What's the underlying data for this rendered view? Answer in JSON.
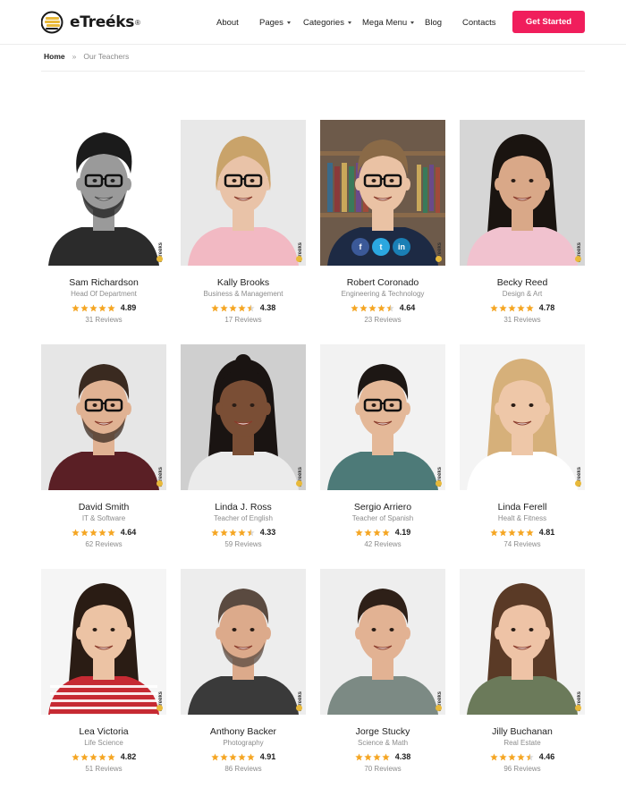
{
  "brand": {
    "name": "eTreéks",
    "reg": "®"
  },
  "nav": {
    "about": "About",
    "pages": "Pages",
    "categories": "Categories",
    "mega_menu": "Mega Menu",
    "blog": "Blog",
    "contacts": "Contacts"
  },
  "cta": {
    "label": "Get Started"
  },
  "breadcrumb": {
    "home": "Home",
    "separator": "»",
    "current": "Our Teachers"
  },
  "watermark": "eTreéks",
  "social": {
    "facebook": "f",
    "twitter": "t",
    "linkedin": "in"
  },
  "colors": {
    "accent": "#f01e5c",
    "star": "#f5a623"
  },
  "teachers": [
    {
      "name": "Sam Richardson",
      "role": "Head Of Department",
      "rating": "4.89",
      "reviews": "31 Reviews",
      "stars": 5
    },
    {
      "name": "Kally Brooks",
      "role": "Business & Management",
      "rating": "4.38",
      "reviews": "17 Reviews",
      "stars": 4.5
    },
    {
      "name": "Robert Coronado",
      "role": "Engineering & Technology",
      "rating": "4.64",
      "reviews": "23 Reviews",
      "stars": 4.5
    },
    {
      "name": "Becky Reed",
      "role": "Design & Art",
      "rating": "4.78",
      "reviews": "31 Reviews",
      "stars": 5
    },
    {
      "name": "David Smith",
      "role": "IT & Software",
      "rating": "4.64",
      "reviews": "62 Reviews",
      "stars": 5
    },
    {
      "name": "Linda J. Ross",
      "role": "Teacher of English",
      "rating": "4.33",
      "reviews": "59 Reviews",
      "stars": 4.5
    },
    {
      "name": "Sergio Arriero",
      "role": "Teacher of Spanish",
      "rating": "4.19",
      "reviews": "42 Reviews",
      "stars": 4
    },
    {
      "name": "Linda Ferell",
      "role": "Healt & Fitness",
      "rating": "4.81",
      "reviews": "74 Reviews",
      "stars": 5
    },
    {
      "name": "Lea Victoria",
      "role": "Life Science",
      "rating": "4.82",
      "reviews": "51 Reviews",
      "stars": 5
    },
    {
      "name": "Anthony Backer",
      "role": "Photography",
      "rating": "4.91",
      "reviews": "86 Reviews",
      "stars": 5
    },
    {
      "name": "Jorge Stucky",
      "role": "Science & Math",
      "rating": "4.38",
      "reviews": "70 Reviews",
      "stars": 4
    },
    {
      "name": "Jilly Buchanan",
      "role": "Real Estate",
      "rating": "4.46",
      "reviews": "96 Reviews",
      "stars": 4.5
    }
  ]
}
